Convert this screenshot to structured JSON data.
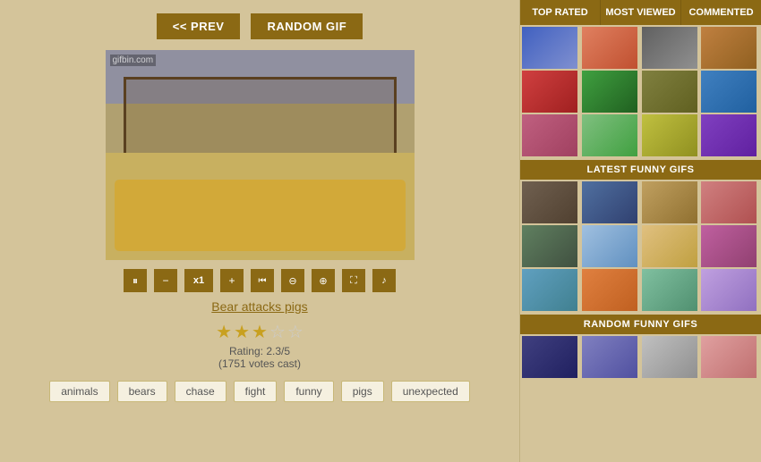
{
  "buttons": {
    "prev_label": "<< PREV",
    "random_label": "RANDOM GIF"
  },
  "gif": {
    "watermark": "gifbin.com",
    "title": "Bear attacks pigs"
  },
  "rating": {
    "value": "2.3/5",
    "votes": "(1751 votes cast)",
    "label": "Rating: 2.3/5"
  },
  "tags": [
    "animals",
    "bears",
    "chase",
    "fight",
    "funny",
    "pigs",
    "unexpected"
  ],
  "controls": [
    {
      "name": "pause",
      "icon": "⏸"
    },
    {
      "name": "minus",
      "icon": "−"
    },
    {
      "name": "speed",
      "icon": "x1"
    },
    {
      "name": "plus",
      "icon": "+"
    },
    {
      "name": "rewind",
      "icon": "⏮"
    },
    {
      "name": "zoom-out",
      "icon": "🔍"
    },
    {
      "name": "zoom-in",
      "icon": "🔍"
    },
    {
      "name": "fullscreen",
      "icon": "⛶"
    },
    {
      "name": "volume",
      "icon": "🔊"
    }
  ],
  "sidebar": {
    "tabs": [
      "TOP RATED",
      "MOST VIEWED",
      "COMMENTED"
    ],
    "active_tab": 0,
    "sections": [
      {
        "label": "LATEST FUNNY GIFS"
      },
      {
        "label": "RANDOM FUNNY GIFS"
      }
    ]
  },
  "thumbnails": {
    "top_rated": [
      "t1",
      "t2",
      "t3",
      "t4",
      "t5",
      "t6",
      "t7",
      "t8",
      "t9",
      "t10",
      "t11",
      "t12"
    ],
    "latest": [
      "t13",
      "t14",
      "t15",
      "t16",
      "t17",
      "t18",
      "t19",
      "t20",
      "t21",
      "t22",
      "t23",
      "t24"
    ],
    "random": [
      "t25",
      "t26",
      "t27",
      "t28"
    ]
  }
}
